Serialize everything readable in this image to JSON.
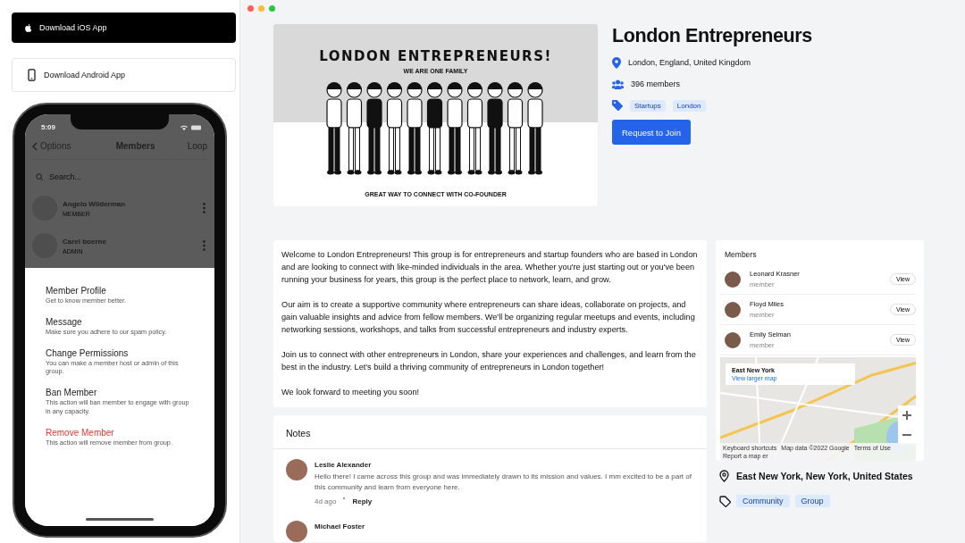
{
  "sidebar": {
    "ios_button": "Download iOS App",
    "android_button": "Download Android App"
  },
  "phone": {
    "time": "5:09",
    "back": "Options",
    "title": "Members",
    "right": "Loop",
    "search_placeholder": "Search...",
    "members": [
      {
        "name": "Angelo Wilderman",
        "role": "MEMBER"
      },
      {
        "name": "Carel boerne",
        "role": "ADMIN"
      }
    ],
    "actions": [
      {
        "kind": "normal",
        "label": "Member Profile",
        "description": "Get to know member better."
      },
      {
        "kind": "normal",
        "label": "Message",
        "description": "Make sure you adhere to our spam policy."
      },
      {
        "kind": "normal",
        "label": "Change Permissions",
        "description": "You can make a member host or admin of this group."
      },
      {
        "kind": "normal",
        "label": "Ban Member",
        "description": "This action will ban member to engage with group in any capacity."
      },
      {
        "kind": "danger",
        "label": "Remove Member",
        "description": "This action will remove member from group."
      }
    ]
  },
  "banner": {
    "heading": "LONDON ENTREPRENEURS!",
    "subheading": "WE ARE ONE FAMILY",
    "footer": "GREAT WAY TO CONNECT WITH CO-FOUNDER"
  },
  "group": {
    "title": "London Entrepreneurs",
    "location": "London, England, United Kingdom",
    "members_count": "396 members",
    "tags": [
      "Startups",
      "London"
    ],
    "join_button": "Request to Join"
  },
  "about": {
    "paragraphs": [
      "Welcome to London Entrepreneurs! This group is for entrepreneurs and startup founders who are based in London and are looking to connect with like-minded individuals in the area. Whether you're just starting out or you've been running your business for years, this group is the perfect place to network, learn, and grow.",
      "Our aim is to create a supportive community where entrepreneurs can share ideas, collaborate on projects, and gain valuable insights and advice from fellow members. We'll be organizing regular meetups and events, including networking sessions, workshops, and talks from successful entrepreneurs and industry experts.",
      "Join us to connect with other entrepreneurs in London, share your experiences and challenges, and learn from the best in the industry. Let's build a thriving community of entrepreneurs in London together!",
      "We look forward to meeting you soon!"
    ]
  },
  "notes": {
    "title": "Notes",
    "items": [
      {
        "author": "Leslie Alexander",
        "text": "Hello there! I came across this group and was immediately drawn to its mission and values. I mm excited to be a part of this community and learn from everyone here.",
        "time": "4d ago",
        "reply": "Reply"
      },
      {
        "author": "Michael Foster"
      }
    ]
  },
  "members_panel": {
    "title": "Members",
    "items": [
      {
        "name": "Leonard Krasner",
        "role": "member",
        "action": "View"
      },
      {
        "name": "Floyd Miles",
        "role": "member",
        "action": "View"
      },
      {
        "name": "Emily Selman",
        "role": "member",
        "action": "View"
      }
    ]
  },
  "map": {
    "place": "East New York",
    "link": "View larger map",
    "footer": [
      "Keyboard shortcuts",
      "Map data ©2022 Google",
      "Terms of Use",
      "Report a map er"
    ]
  },
  "location": "East New York, New York, United States",
  "tags": [
    "Community",
    "Group"
  ]
}
